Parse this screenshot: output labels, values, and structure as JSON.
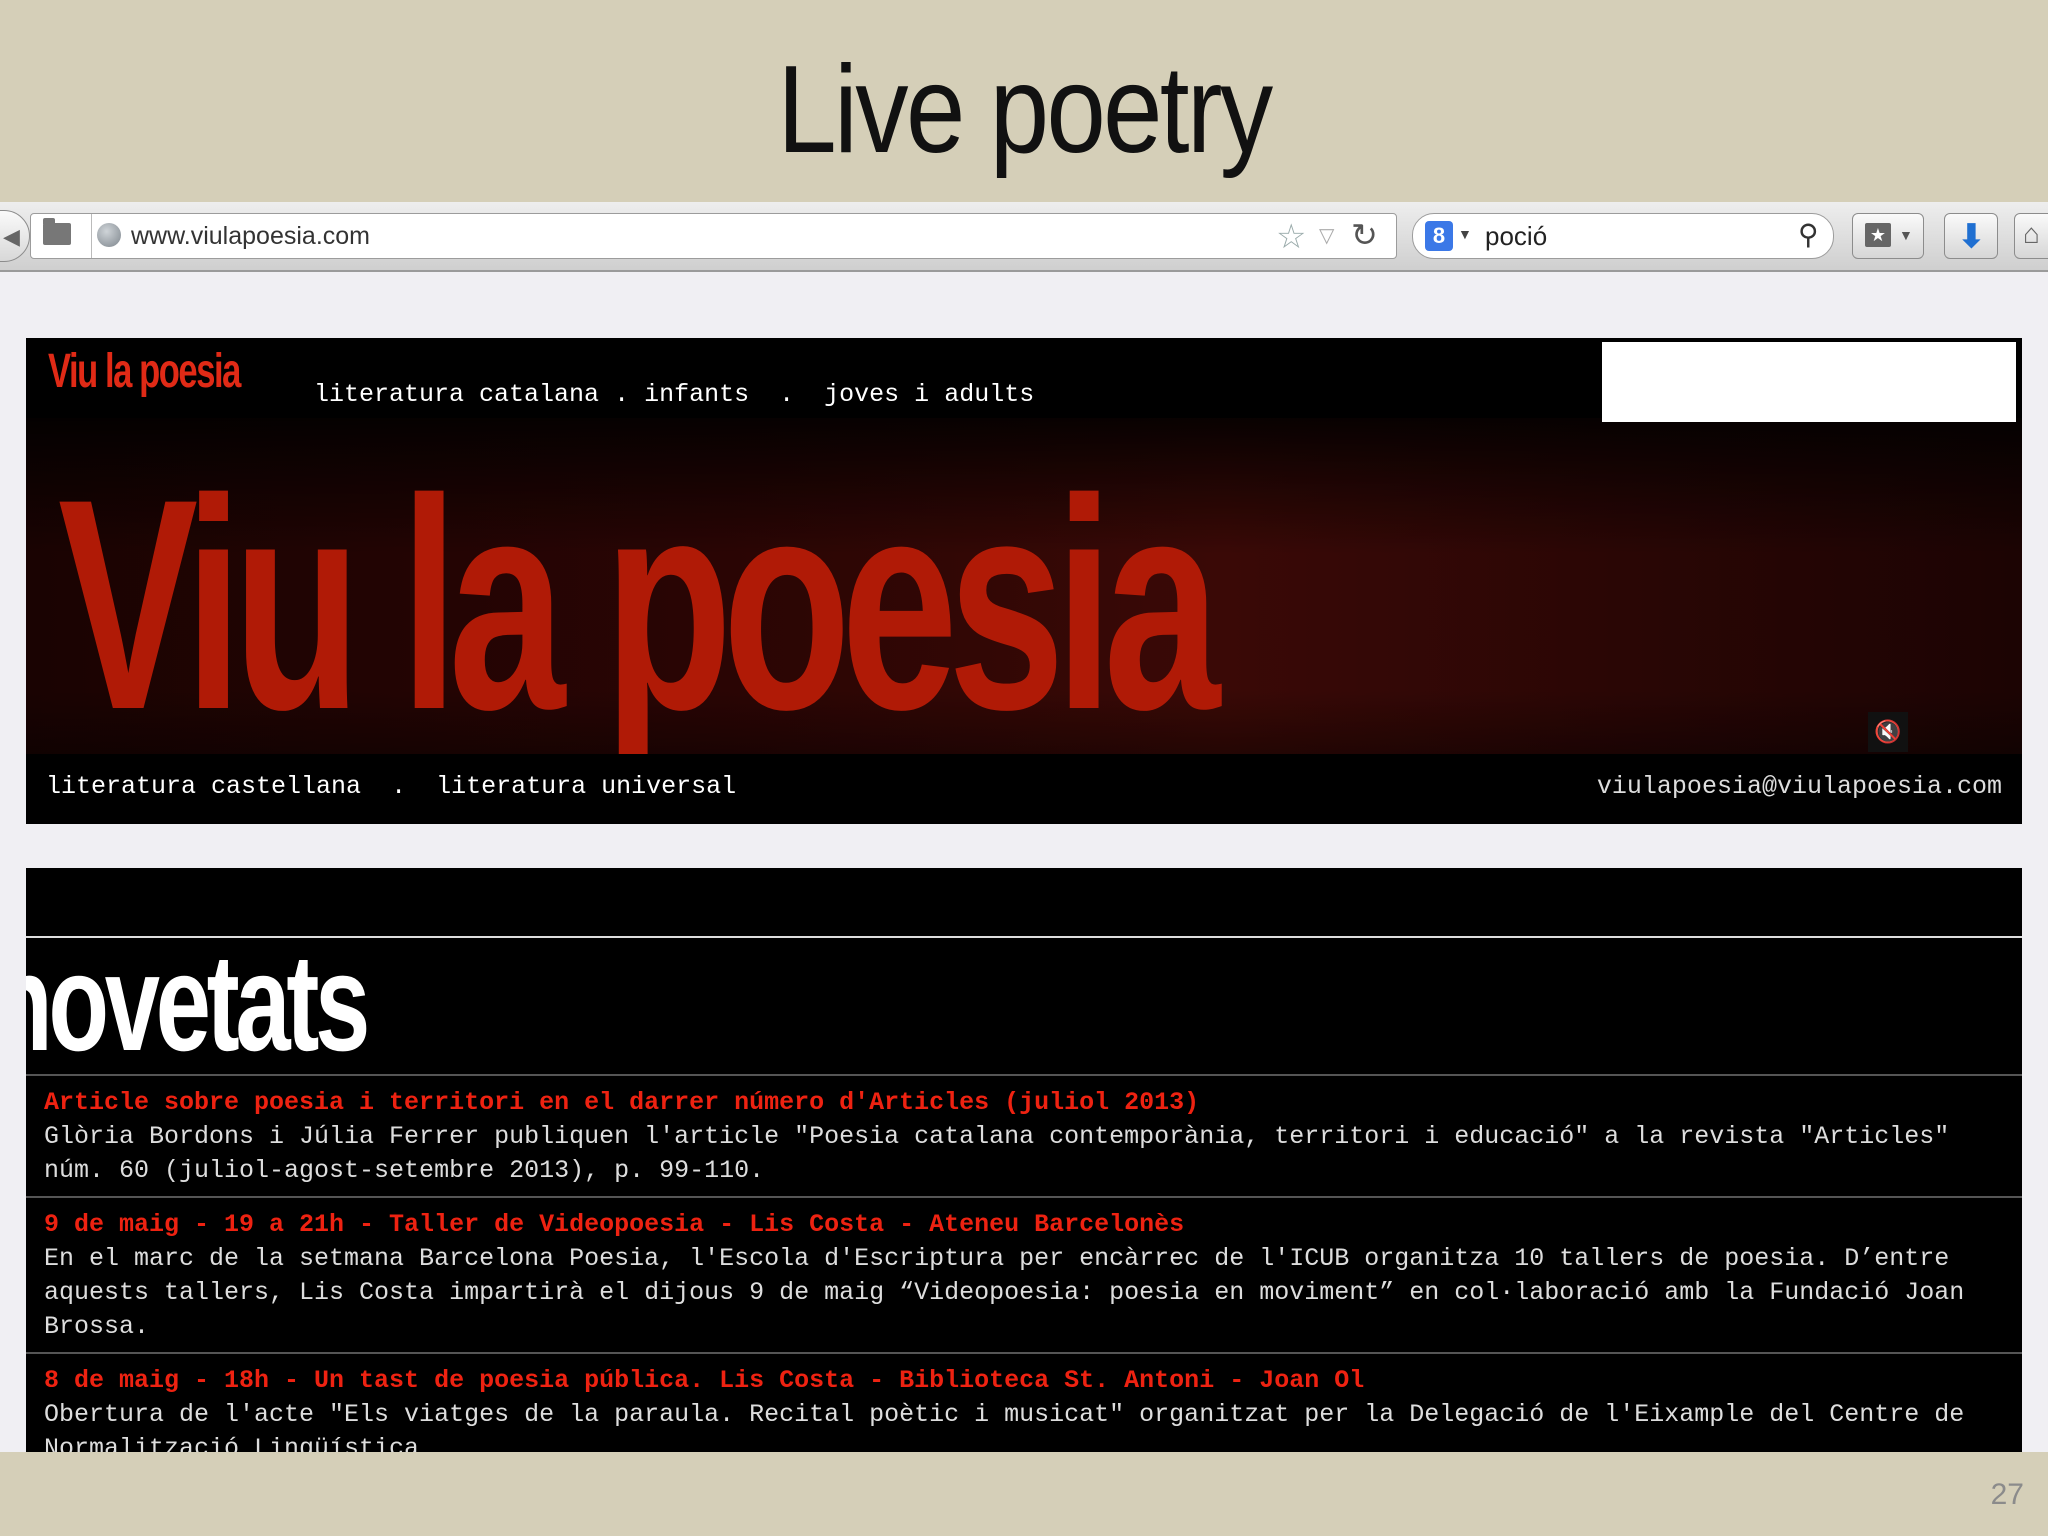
{
  "slide": {
    "title": "Live poetry",
    "page_number": "27"
  },
  "browser": {
    "url": "www.viulapoesia.com",
    "search_query": "poció",
    "search_engine_icon": "8",
    "icons": [
      "back-icon",
      "folder-icon",
      "globe-icon",
      "star-icon",
      "dropdown-icon",
      "reload-icon",
      "search-engine-icon",
      "magnifier-icon",
      "bookmarks-icon",
      "download-icon",
      "home-icon"
    ]
  },
  "site": {
    "logo_small": "Viu la poesia",
    "topnav": [
      "literatura catalana",
      ".",
      "infants",
      ".",
      "joves i adults"
    ],
    "big_title": "Viu la poesia",
    "mute_icon": "🔇",
    "bottomnav": [
      "literatura castellana",
      ".",
      "literatura universal"
    ],
    "email": "viulapoesia@viulapoesia.com",
    "accent_color": "#b01a06",
    "link_color": "#ee2211"
  },
  "news": {
    "heading": "novetats",
    "items": [
      {
        "title": "Article sobre poesia i territori en el darrer número d'Articles (juliol 2013)",
        "body": "Glòria Bordons i Júlia Ferrer publiquen l'article \"Poesia catalana contemporània, territori i educació\" a la revista \"Articles\" núm. 60 (juliol-agost-setembre 2013), p. 99-110."
      },
      {
        "title": "9 de maig - 19 a 21h - Taller de Videopoesia - Lis Costa - Ateneu Barcelonès",
        "body": "En el marc de la setmana Barcelona Poesia, l'Escola d'Escriptura per encàrrec de l'ICUB organitza 10 tallers de poesia. D’entre aquests tallers, Lis Costa impartirà el dijous 9 de maig “Videopoesia: poesia en moviment” en col·laboració amb la Fundació Joan Brossa."
      },
      {
        "title": "8 de maig - 18h - Un tast de poesia pública. Lis Costa - Biblioteca St. Antoni - Joan Ol",
        "body": "Obertura de l'acte \"Els viatges de la paraula. Recital poètic i musicat\" organitzat per la Delegació de l'Eixample del Centre de Normalització Lingüística"
      }
    ]
  }
}
